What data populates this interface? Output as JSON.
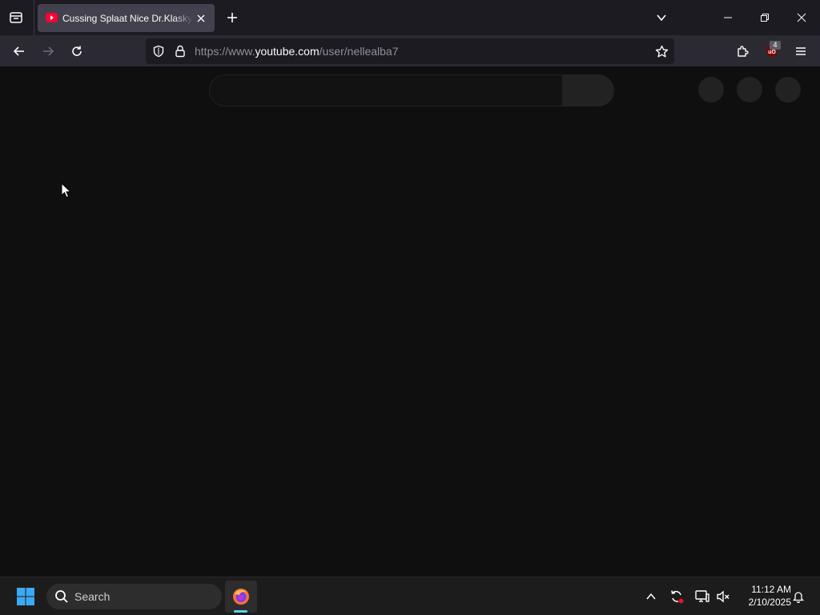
{
  "browser": {
    "tab": {
      "title": "Cussing Splaat Nice Dr.Klasky c",
      "favicon": "youtube-icon"
    },
    "url": {
      "prefix": "https://www.",
      "host": "youtube.com",
      "path": "/user/nellealba7"
    },
    "extensions": {
      "ublock_badge": "4"
    },
    "icons": {
      "tab_list": "tab-list-icon",
      "new_tab": "plus-icon",
      "back": "arrow-left-icon",
      "forward": "arrow-right-icon",
      "reload": "reload-icon",
      "tracking_protection": "shield-icon",
      "lock": "lock-icon",
      "bookmark": "star-icon",
      "extensions": "puzzle-icon",
      "menu": "hamburger-icon"
    }
  },
  "taskbar": {
    "search_label": "Search",
    "time": "11:12 AM",
    "date": "2/10/2025"
  },
  "colors": {
    "page_bg": "#0f0f0f",
    "tabbar_bg": "#1c1b22",
    "navbar_bg": "#2b2a33",
    "youtube_red": "#ff0033",
    "taskbar_bg": "#1c1c1c",
    "taskbar_indicator": "#60cdff"
  }
}
